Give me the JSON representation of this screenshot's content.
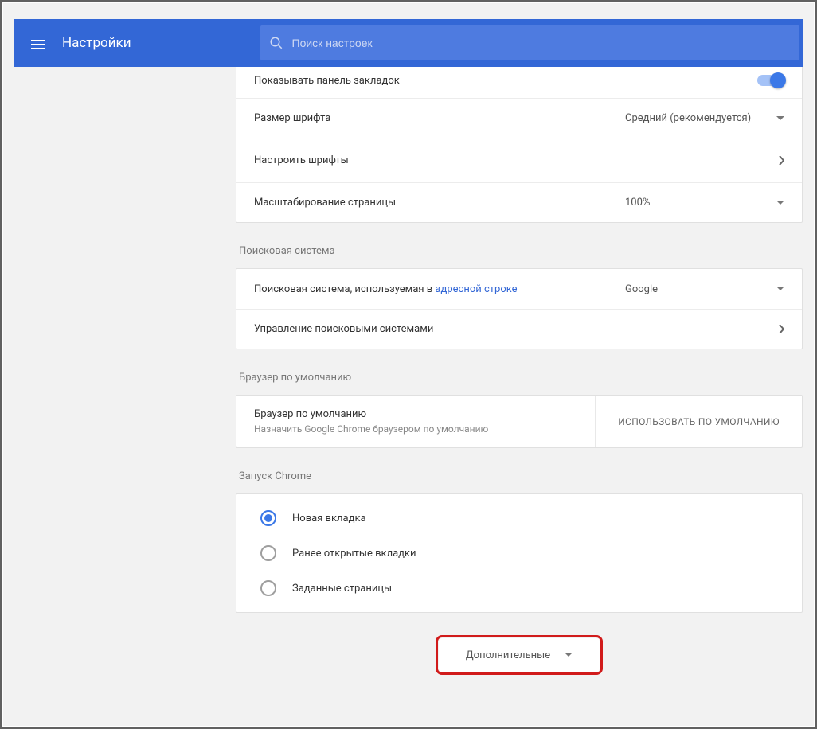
{
  "header": {
    "title": "Настройки",
    "search_placeholder": "Поиск настроек"
  },
  "appearance": {
    "bookmarks_bar": "Показывать панель закладок",
    "font_size_label": "Размер шрифта",
    "font_size_value": "Средний (рекомендуется)",
    "customize_fonts": "Настроить шрифты",
    "page_zoom_label": "Масштабирование страницы",
    "page_zoom_value": "100%"
  },
  "search_engine": {
    "section": "Поисковая система",
    "used_in_prefix": "Поисковая система, используемая в ",
    "used_in_link": "адресной строке",
    "engine_value": "Google",
    "manage": "Управление поисковыми системами"
  },
  "default_browser": {
    "section": "Браузер по умолчанию",
    "title": "Браузер по умолчанию",
    "desc": "Назначить Google Chrome браузером по умолчанию",
    "button": "ИСПОЛЬЗОВАТЬ ПО УМОЛЧАНИЮ"
  },
  "startup": {
    "section": "Запуск Chrome",
    "options": [
      "Новая вкладка",
      "Ранее открытые вкладки",
      "Заданные страницы"
    ],
    "selected": 0
  },
  "advanced": "Дополнительные"
}
